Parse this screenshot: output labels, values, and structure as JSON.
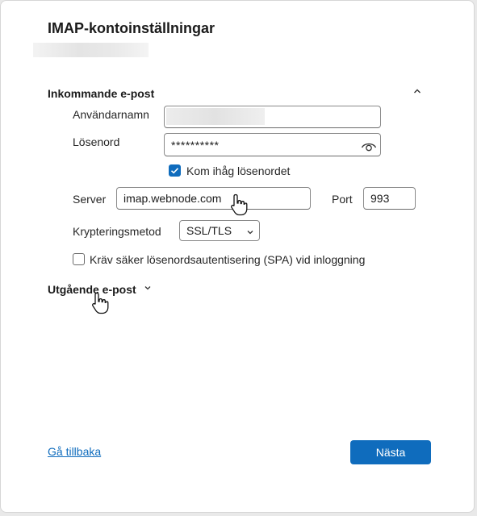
{
  "dialog": {
    "title": "IMAP-kontoinställningar"
  },
  "incoming": {
    "heading": "Inkommande e-post",
    "username_label": "Användarnamn",
    "password_label": "Lösenord",
    "password_value": "**********",
    "remember_label": "Kom ihåg lösenordet",
    "remember_checked": true,
    "server_label": "Server",
    "server_value": "imap.webnode.com",
    "port_label": "Port",
    "port_value": "993",
    "encryption_label": "Krypteringsmetod",
    "encryption_value": "SSL/TLS",
    "spa_label": "Kräv säker lösenordsautentisering (SPA) vid inloggning",
    "spa_checked": false
  },
  "outgoing": {
    "heading": "Utgående e-post"
  },
  "footer": {
    "back_link": "Gå tillbaka",
    "next_button": "Nästa"
  },
  "colors": {
    "accent": "#0f6cbd"
  },
  "icons": {
    "collapse": "chevron-up-icon",
    "expand": "chevron-down-icon",
    "reveal": "eye-icon",
    "pointer": "hand-pointer-icon"
  }
}
